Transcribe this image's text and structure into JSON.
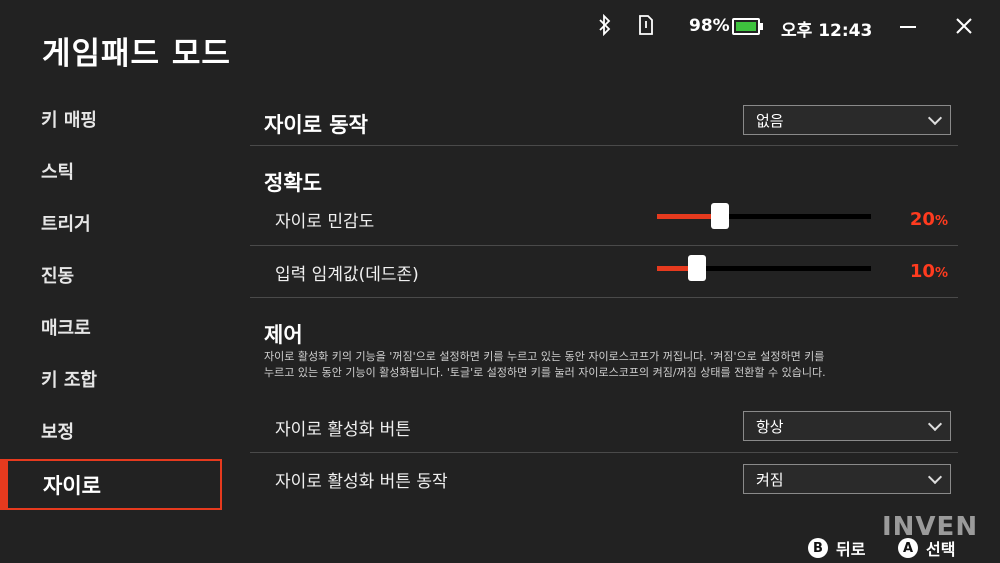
{
  "status_bar": {
    "bluetooth_icon": "bluetooth-icon",
    "sim_icon": "sim-card-icon",
    "battery_percent": "98%",
    "battery_level": 0.98,
    "time": "오후 12:43"
  },
  "window": {
    "minimize_icon": "minimize-icon",
    "close_icon": "close-icon"
  },
  "page_title": "게임패드 모드",
  "sidebar": {
    "items": [
      {
        "label": "키 매핑"
      },
      {
        "label": "스틱"
      },
      {
        "label": "트리거"
      },
      {
        "label": "진동"
      },
      {
        "label": "매크로"
      },
      {
        "label": "키 조합"
      },
      {
        "label": "보정"
      },
      {
        "label": "자이로"
      }
    ],
    "active_index": 7
  },
  "gyro_action": {
    "label": "자이로 동작",
    "value": "없음"
  },
  "accuracy": {
    "heading": "정확도",
    "sensitivity": {
      "label": "자이로 민감도",
      "value": 20,
      "number": "20",
      "unit": "%"
    },
    "deadzone": {
      "label": "입력 임계값(데드존)",
      "value": 10,
      "number": "10",
      "unit": "%"
    }
  },
  "control": {
    "heading": "제어",
    "description_line1": "자이로 활성화 키의 기능을 '꺼짐'으로 설정하면 키를 누르고 있는 동안 자이로스코프가 꺼집니다. '켜짐'으로 설정하면 키를",
    "description_line2": "누르고 있는 동안 기능이 활성화됩니다. '토글'로 설정하면 키를 눌러 자이로스코프의 켜짐/꺼짐 상태를 전환할 수 있습니다.",
    "activate_button": {
      "label": "자이로 활성화 버튼",
      "value": "항상"
    },
    "activate_button_action": {
      "label": "자이로 활성화 버튼 동작",
      "value": "켜짐"
    }
  },
  "footer": {
    "back_key": "B",
    "back_label": "뒤로",
    "select_key": "A",
    "select_label": "선택"
  },
  "watermark": "INVEN",
  "colors": {
    "accent": "#e63a1e",
    "background": "#222222",
    "battery": "#3ec33e"
  }
}
